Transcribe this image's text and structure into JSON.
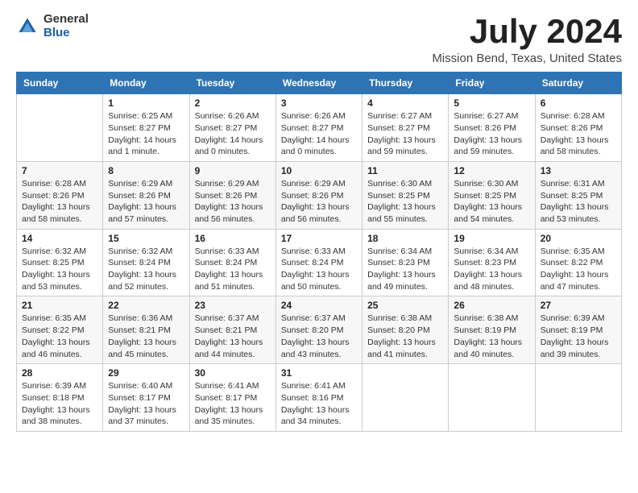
{
  "logo": {
    "general": "General",
    "blue": "Blue"
  },
  "title": "July 2024",
  "location": "Mission Bend, Texas, United States",
  "days_of_week": [
    "Sunday",
    "Monday",
    "Tuesday",
    "Wednesday",
    "Thursday",
    "Friday",
    "Saturday"
  ],
  "weeks": [
    [
      {
        "day": "",
        "info": ""
      },
      {
        "day": "1",
        "info": "Sunrise: 6:25 AM\nSunset: 8:27 PM\nDaylight: 14 hours\nand 1 minute."
      },
      {
        "day": "2",
        "info": "Sunrise: 6:26 AM\nSunset: 8:27 PM\nDaylight: 14 hours\nand 0 minutes."
      },
      {
        "day": "3",
        "info": "Sunrise: 6:26 AM\nSunset: 8:27 PM\nDaylight: 14 hours\nand 0 minutes."
      },
      {
        "day": "4",
        "info": "Sunrise: 6:27 AM\nSunset: 8:27 PM\nDaylight: 13 hours\nand 59 minutes."
      },
      {
        "day": "5",
        "info": "Sunrise: 6:27 AM\nSunset: 8:26 PM\nDaylight: 13 hours\nand 59 minutes."
      },
      {
        "day": "6",
        "info": "Sunrise: 6:28 AM\nSunset: 8:26 PM\nDaylight: 13 hours\nand 58 minutes."
      }
    ],
    [
      {
        "day": "7",
        "info": "Sunrise: 6:28 AM\nSunset: 8:26 PM\nDaylight: 13 hours\nand 58 minutes."
      },
      {
        "day": "8",
        "info": "Sunrise: 6:29 AM\nSunset: 8:26 PM\nDaylight: 13 hours\nand 57 minutes."
      },
      {
        "day": "9",
        "info": "Sunrise: 6:29 AM\nSunset: 8:26 PM\nDaylight: 13 hours\nand 56 minutes."
      },
      {
        "day": "10",
        "info": "Sunrise: 6:29 AM\nSunset: 8:26 PM\nDaylight: 13 hours\nand 56 minutes."
      },
      {
        "day": "11",
        "info": "Sunrise: 6:30 AM\nSunset: 8:25 PM\nDaylight: 13 hours\nand 55 minutes."
      },
      {
        "day": "12",
        "info": "Sunrise: 6:30 AM\nSunset: 8:25 PM\nDaylight: 13 hours\nand 54 minutes."
      },
      {
        "day": "13",
        "info": "Sunrise: 6:31 AM\nSunset: 8:25 PM\nDaylight: 13 hours\nand 53 minutes."
      }
    ],
    [
      {
        "day": "14",
        "info": "Sunrise: 6:32 AM\nSunset: 8:25 PM\nDaylight: 13 hours\nand 53 minutes."
      },
      {
        "day": "15",
        "info": "Sunrise: 6:32 AM\nSunset: 8:24 PM\nDaylight: 13 hours\nand 52 minutes."
      },
      {
        "day": "16",
        "info": "Sunrise: 6:33 AM\nSunset: 8:24 PM\nDaylight: 13 hours\nand 51 minutes."
      },
      {
        "day": "17",
        "info": "Sunrise: 6:33 AM\nSunset: 8:24 PM\nDaylight: 13 hours\nand 50 minutes."
      },
      {
        "day": "18",
        "info": "Sunrise: 6:34 AM\nSunset: 8:23 PM\nDaylight: 13 hours\nand 49 minutes."
      },
      {
        "day": "19",
        "info": "Sunrise: 6:34 AM\nSunset: 8:23 PM\nDaylight: 13 hours\nand 48 minutes."
      },
      {
        "day": "20",
        "info": "Sunrise: 6:35 AM\nSunset: 8:22 PM\nDaylight: 13 hours\nand 47 minutes."
      }
    ],
    [
      {
        "day": "21",
        "info": "Sunrise: 6:35 AM\nSunset: 8:22 PM\nDaylight: 13 hours\nand 46 minutes."
      },
      {
        "day": "22",
        "info": "Sunrise: 6:36 AM\nSunset: 8:21 PM\nDaylight: 13 hours\nand 45 minutes."
      },
      {
        "day": "23",
        "info": "Sunrise: 6:37 AM\nSunset: 8:21 PM\nDaylight: 13 hours\nand 44 minutes."
      },
      {
        "day": "24",
        "info": "Sunrise: 6:37 AM\nSunset: 8:20 PM\nDaylight: 13 hours\nand 43 minutes."
      },
      {
        "day": "25",
        "info": "Sunrise: 6:38 AM\nSunset: 8:20 PM\nDaylight: 13 hours\nand 41 minutes."
      },
      {
        "day": "26",
        "info": "Sunrise: 6:38 AM\nSunset: 8:19 PM\nDaylight: 13 hours\nand 40 minutes."
      },
      {
        "day": "27",
        "info": "Sunrise: 6:39 AM\nSunset: 8:19 PM\nDaylight: 13 hours\nand 39 minutes."
      }
    ],
    [
      {
        "day": "28",
        "info": "Sunrise: 6:39 AM\nSunset: 8:18 PM\nDaylight: 13 hours\nand 38 minutes."
      },
      {
        "day": "29",
        "info": "Sunrise: 6:40 AM\nSunset: 8:17 PM\nDaylight: 13 hours\nand 37 minutes."
      },
      {
        "day": "30",
        "info": "Sunrise: 6:41 AM\nSunset: 8:17 PM\nDaylight: 13 hours\nand 35 minutes."
      },
      {
        "day": "31",
        "info": "Sunrise: 6:41 AM\nSunset: 8:16 PM\nDaylight: 13 hours\nand 34 minutes."
      },
      {
        "day": "",
        "info": ""
      },
      {
        "day": "",
        "info": ""
      },
      {
        "day": "",
        "info": ""
      }
    ]
  ]
}
